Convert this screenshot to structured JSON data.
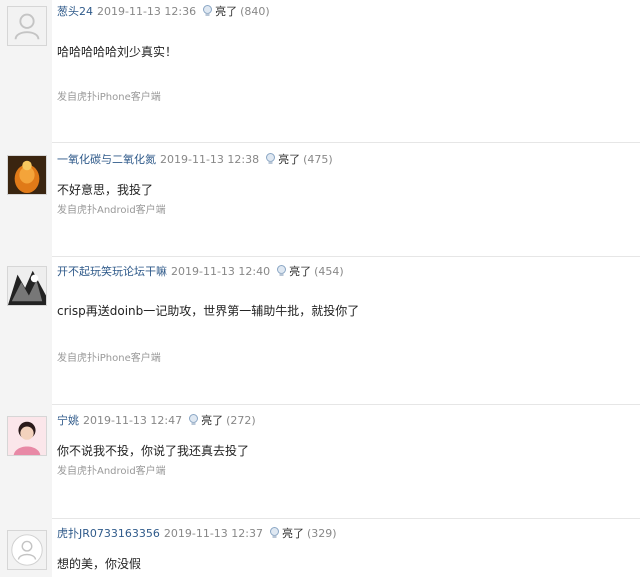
{
  "light_label": "亮了",
  "posts": [
    {
      "username": "葱头24",
      "time": "2019-11-13 12:36",
      "light_count": "(840)",
      "content": "哈哈哈哈哈刘少真实！",
      "source": "发自虎扑iPhone客户端",
      "avatar": "default-avatar"
    },
    {
      "username": "一氧化碳与二氧化氮",
      "time": "2019-11-13 12:38",
      "light_count": "(475)",
      "content": "不好意思，我投了",
      "source": "发自虎扑Android客户端",
      "avatar": "photo-avatar-orange"
    },
    {
      "username": "开不起玩笑玩论坛干嘛",
      "time": "2019-11-13 12:40",
      "light_count": "(454)",
      "content": "crisp再送doinb一记助攻，世界第一辅助牛批，就投你了",
      "source": "发自虎扑iPhone客户端",
      "avatar": "photo-avatar-bw"
    },
    {
      "username": "宁姚",
      "time": "2019-11-13 12:47",
      "light_count": "(272)",
      "content": "你不说我不投，你说了我还真去投了",
      "source": "发自虎扑Android客户端",
      "avatar": "photo-avatar-girl"
    },
    {
      "username": "虎扑JR0733163356",
      "time": "2019-11-13 12:37",
      "light_count": "(329)",
      "content": "想的美，你没假",
      "source": "",
      "avatar": "default-round-avatar"
    }
  ]
}
